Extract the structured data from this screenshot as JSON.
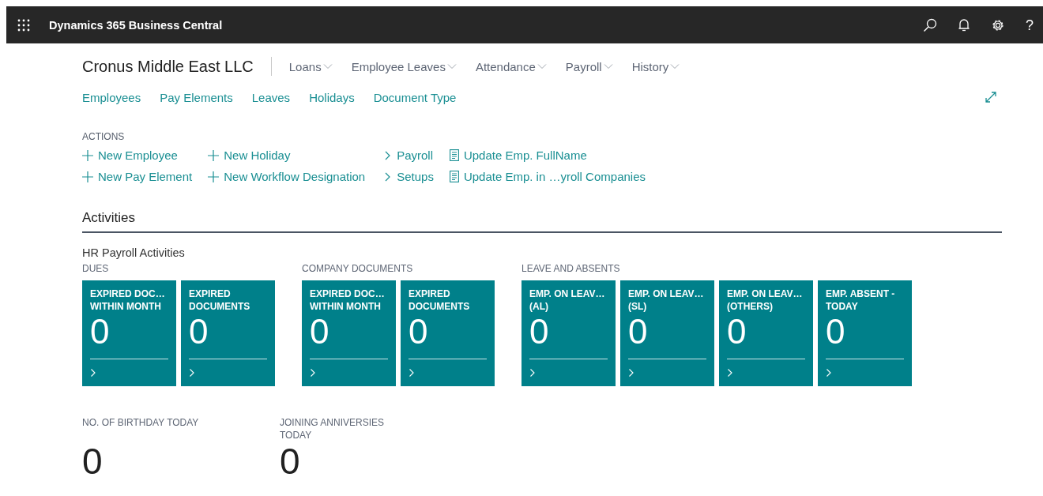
{
  "app_bar": {
    "title": "Dynamics 365 Business Central",
    "help": "?"
  },
  "header": {
    "company": "Cronus Middle East LLC",
    "menus": [
      {
        "label": "Loans"
      },
      {
        "label": "Employee Leaves"
      },
      {
        "label": "Attendance"
      },
      {
        "label": "Payroll"
      },
      {
        "label": "History"
      }
    ],
    "links": [
      "Employees",
      "Pay Elements",
      "Leaves",
      "Holidays",
      "Document Type"
    ]
  },
  "actions": {
    "title": "ACTIONS",
    "columns": [
      [
        {
          "kind": "new",
          "label": "New Employee"
        },
        {
          "kind": "new",
          "label": "New Pay Element"
        }
      ],
      [
        {
          "kind": "new",
          "label": "New Holiday"
        },
        {
          "kind": "new",
          "label": "New Workflow Designation"
        }
      ],
      [
        {
          "kind": "submenu",
          "label": "Payroll"
        },
        {
          "kind": "submenu",
          "label": "Setups"
        }
      ],
      [
        {
          "kind": "report",
          "label": "Update Emp. FullName"
        },
        {
          "kind": "report",
          "label": "Update Emp. in …yroll Companies"
        }
      ]
    ]
  },
  "activities": {
    "title": "Activities",
    "part_title": "HR Payroll Activities",
    "groups": [
      {
        "title": "DUES",
        "tiles": [
          {
            "label": "EXPIRED DOC… WITHIN MONTH",
            "value": "0"
          },
          {
            "label": "EXPIRED DOCUMENTS",
            "value": "0"
          }
        ]
      },
      {
        "title": "COMPANY DOCUMENTS",
        "tiles": [
          {
            "label": "EXPIRED DOC… WITHIN MONTH",
            "value": "0"
          },
          {
            "label": "EXPIRED DOCUMENTS",
            "value": "0"
          }
        ]
      },
      {
        "title": "LEAVE AND ABSENTS",
        "tiles": [
          {
            "label": "EMP. ON LEAV… (AL)",
            "value": "0"
          },
          {
            "label": "EMP. ON LEAV… (SL)",
            "value": "0"
          },
          {
            "label": "EMP. ON LEAV… (OTHERS)",
            "value": "0"
          },
          {
            "label": "EMP. ABSENT - TODAY",
            "value": "0"
          }
        ]
      }
    ],
    "counters": [
      {
        "label": "NO. OF BIRTHDAY TODAY",
        "value": "0"
      },
      {
        "label": "JOINING ANNIVERSIES TODAY",
        "value": "0"
      }
    ]
  }
}
